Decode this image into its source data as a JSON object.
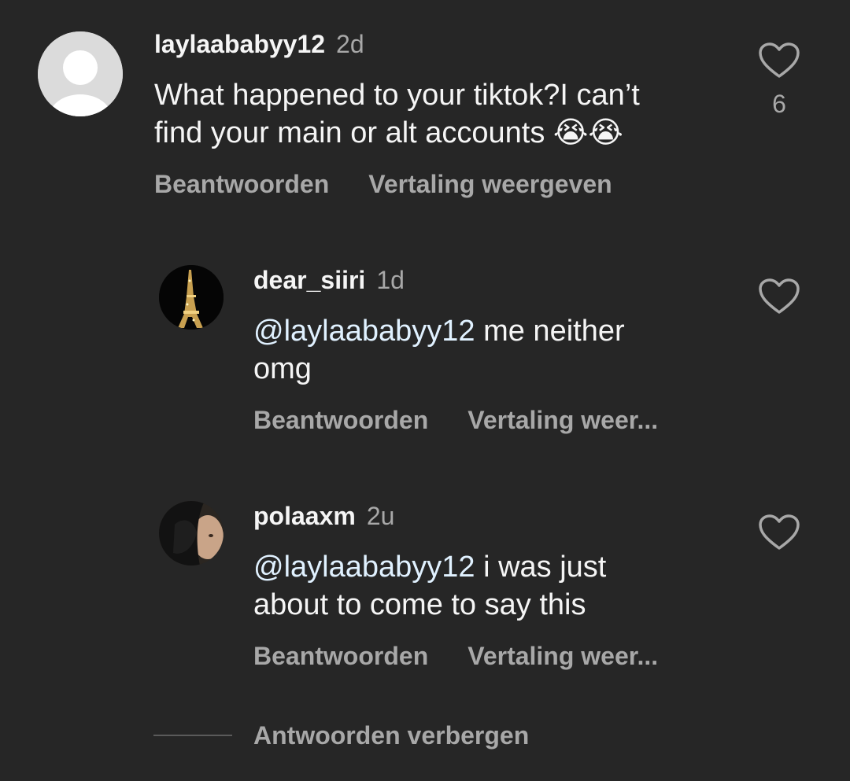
{
  "comment": {
    "username": "laylaababyy12",
    "time": "2d",
    "text_line1": "What happened to your tiktok?I can’t",
    "text_line2": "find your main or alt accounts",
    "emoji": "😭😭",
    "reply_label": "Beantwoorden",
    "translate_label": "Vertaling weergeven",
    "like_count": "6",
    "like_icon": "heart-outline-icon"
  },
  "replies": [
    {
      "username": "dear_siiri",
      "time": "1d",
      "mention": "@laylaababyy12",
      "text_line1": " me neither",
      "text_line2": "omg",
      "reply_label": "Beantwoorden",
      "translate_label": "Vertaling weer...",
      "avatar": "eiffel-tower-photo"
    },
    {
      "username": "polaaxm",
      "time": "2u",
      "mention": "@laylaababyy12",
      "text_line1": " i was just",
      "text_line2": "about to come to say this",
      "reply_label": "Beantwoorden",
      "translate_label": "Vertaling weer...",
      "avatar": "selfie-photo"
    }
  ],
  "hide_replies_label": "Antwoorden verbergen",
  "colors": {
    "background": "#262626",
    "primary_text": "#f5f5f5",
    "secondary_text": "#a8a8a8",
    "mention": "#e0f1ff"
  }
}
